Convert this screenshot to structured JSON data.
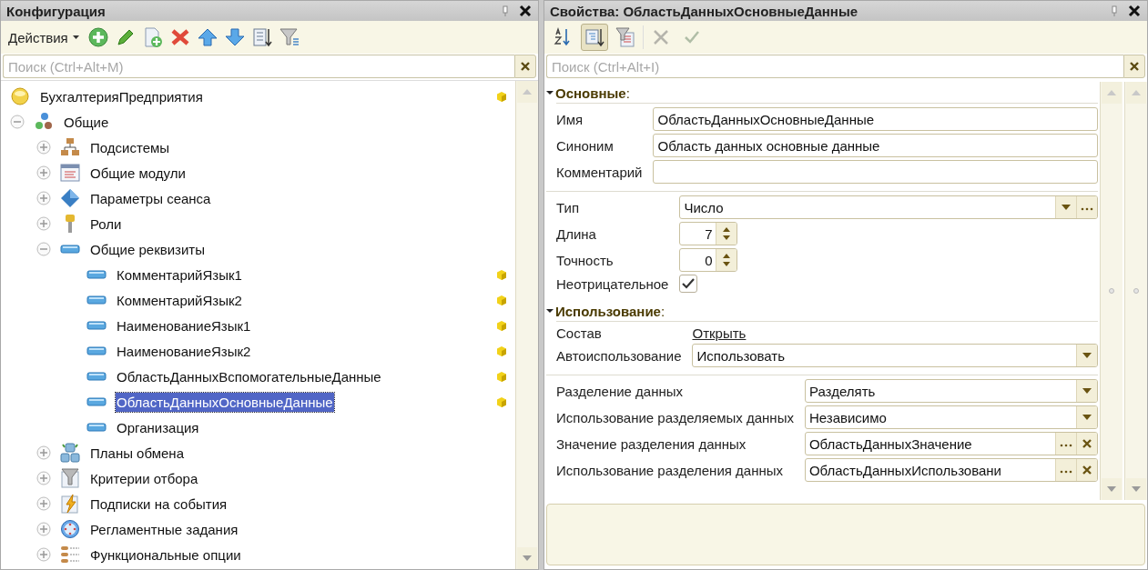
{
  "config_panel": {
    "title": "Конфигурация",
    "actions_menu": "Действия",
    "search": {
      "placeholder": "Поиск (Ctrl+Alt+M)"
    },
    "tree": [
      {
        "label": "БухгалтерияПредприятия",
        "kind": "configuration",
        "supported": true,
        "selected": false,
        "children": [
          {
            "label": "Общие",
            "kind": "common",
            "supported": false,
            "expanded": true,
            "selected": false,
            "children": [
              {
                "label": "Подсистемы",
                "kind": "subsystems",
                "supported": false,
                "expanded": false,
                "selected": false
              },
              {
                "label": "Общие модули",
                "kind": "modules",
                "supported": false,
                "expanded": false,
                "selected": false
              },
              {
                "label": "Параметры сеанса",
                "kind": "session",
                "supported": false,
                "expanded": false,
                "selected": false
              },
              {
                "label": "Роли",
                "kind": "roles",
                "supported": false,
                "expanded": false,
                "selected": false
              },
              {
                "label": "Общие реквизиты",
                "kind": "attribute",
                "supported": false,
                "expanded": true,
                "selected": false,
                "children": [
                  {
                    "label": "КомментарийЯзык1",
                    "kind": "attribute",
                    "supported": true,
                    "selected": false
                  },
                  {
                    "label": "КомментарийЯзык2",
                    "kind": "attribute",
                    "supported": true,
                    "selected": false
                  },
                  {
                    "label": "НаименованиеЯзык1",
                    "kind": "attribute",
                    "supported": true,
                    "selected": false
                  },
                  {
                    "label": "НаименованиеЯзык2",
                    "kind": "attribute",
                    "supported": true,
                    "selected": false
                  },
                  {
                    "label": "ОбластьДанныхВспомогательныеДанные",
                    "kind": "attribute",
                    "supported": true,
                    "selected": false
                  },
                  {
                    "label": "ОбластьДанныхОсновныеДанные",
                    "kind": "attribute",
                    "supported": true,
                    "selected": true
                  },
                  {
                    "label": "Организация",
                    "kind": "attribute",
                    "supported": false,
                    "selected": false
                  }
                ]
              },
              {
                "label": "Планы обмена",
                "kind": "exchange",
                "supported": false,
                "expanded": false,
                "selected": false
              },
              {
                "label": "Критерии отбора",
                "kind": "criteria",
                "supported": false,
                "expanded": false,
                "selected": false
              },
              {
                "label": "Подписки на события",
                "kind": "subscriptions",
                "supported": false,
                "expanded": false,
                "selected": false
              },
              {
                "label": "Регламентные задания",
                "kind": "scheduled",
                "supported": false,
                "expanded": false,
                "selected": false
              },
              {
                "label": "Функциональные опции",
                "kind": "options",
                "supported": false,
                "expanded": false,
                "selected": false
              }
            ]
          }
        ]
      }
    ]
  },
  "properties_panel": {
    "title": "Свойства: ОбластьДанныхОсновныеДанные",
    "tools": [
      {
        "selected": false,
        "disabled": false
      },
      {
        "selected": true,
        "disabled": false
      },
      {
        "selected": false,
        "disabled": false
      },
      {
        "selected": false,
        "disabled": true
      },
      {
        "selected": false,
        "disabled": true
      }
    ],
    "search": {
      "placeholder": "Поиск (Ctrl+Alt+I)"
    },
    "sections": [
      {
        "title": "**Основные**:",
        "expanded": true,
        "groups": [
          [
            {
              "kind": "text",
              "label": "Имя",
              "value": "ОбластьДанныхОсновныеДанные"
            },
            {
              "kind": "text",
              "label": "Синоним",
              "value": "Область данных основные данные"
            },
            {
              "kind": "text",
              "label": "Комментарий"
            }
          ],
          [
            {
              "kind": "type",
              "label": "Тип",
              "value": "Число"
            },
            {
              "kind": "number",
              "label": "Длина",
              "value": "7"
            },
            {
              "kind": "number",
              "label": "Точность",
              "value": "0"
            },
            {
              "kind": "checkbox",
              "label": "Неотрицательное",
              "checked": true
            }
          ]
        ]
      },
      {
        "title": "**Использование**:",
        "expanded": true,
        "groups": [
          [
            {
              "kind": "link",
              "label": "Состав",
              "value": "Открыть"
            },
            {
              "kind": "dropdown",
              "label": "Автоиспользование",
              "value": "Использовать"
            }
          ],
          [
            {
              "kind": "dropdown",
              "label": "Разделение данных",
              "value": "Разделять"
            },
            {
              "kind": "dropdown",
              "label": "Использование разделяемых данных",
              "value": "Независимо"
            },
            {
              "kind": "choice",
              "label": "Значение разделения данных",
              "value": "ОбластьДанныхЗначение"
            },
            {
              "kind": "choice",
              "label": "Использование разделения данных",
              "value": "ОбластьДанныхИспользовани"
            }
          ]
        ]
      }
    ]
  }
}
